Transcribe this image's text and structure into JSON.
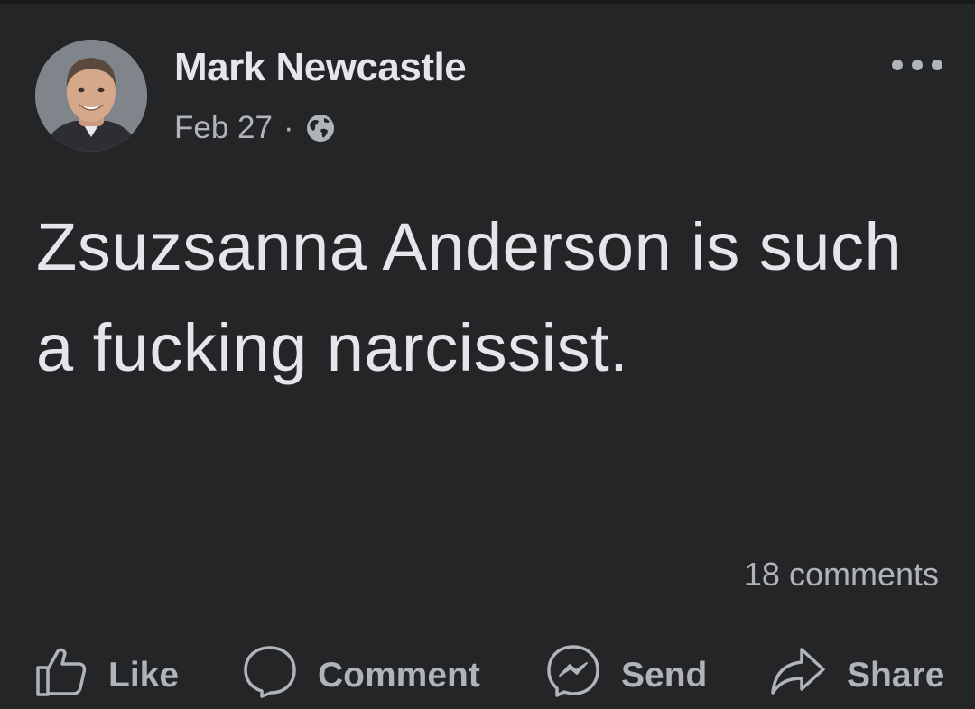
{
  "post": {
    "author_name": "Mark Newcastle",
    "date": "Feb 27",
    "separator": "·",
    "privacy_icon": "globe-icon",
    "text": "Zsuzsanna Anderson is such a fucking narcissist.",
    "comments_count": "18 comments"
  },
  "actions": {
    "like_label": "Like",
    "comment_label": "Comment",
    "send_label": "Send",
    "share_label": "Share"
  },
  "colors": {
    "background": "#242526",
    "primary_text": "#e4e6eb",
    "secondary_text": "#b0b3b8"
  }
}
